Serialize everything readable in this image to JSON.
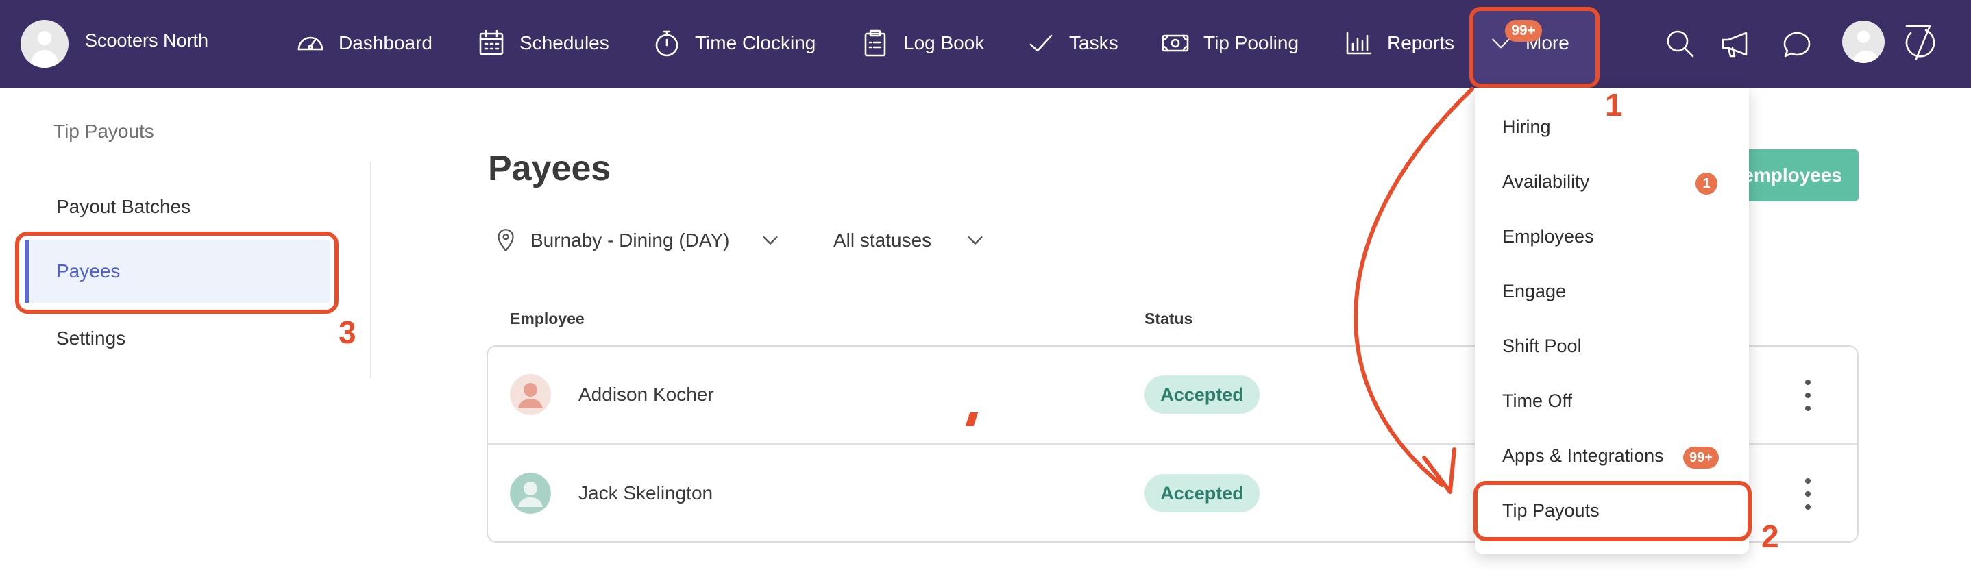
{
  "header": {
    "brand_name": "Scooters North",
    "nav": [
      {
        "label": "Dashboard",
        "icon": "dashboard-icon"
      },
      {
        "label": "Schedules",
        "icon": "calendar-icon"
      },
      {
        "label": "Time Clocking",
        "icon": "stopwatch-icon"
      },
      {
        "label": "Log Book",
        "icon": "clipboard-icon"
      },
      {
        "label": "Tasks",
        "icon": "checkmark-icon"
      },
      {
        "label": "Tip Pooling",
        "icon": "cash-icon"
      },
      {
        "label": "Reports",
        "icon": "bar-chart-icon"
      }
    ],
    "more_label": "More",
    "more_badge": "99+",
    "utility_icons": [
      "search-icon",
      "megaphone-icon",
      "chat-icon",
      "avatar",
      "logo-icon"
    ]
  },
  "sidebar": {
    "title": "Tip Payouts",
    "items": [
      {
        "label": "Payout Batches",
        "active": false
      },
      {
        "label": "Payees",
        "active": true
      },
      {
        "label": "Settings",
        "active": false
      }
    ]
  },
  "main": {
    "title": "Payees",
    "location_filter": "Burnaby - Dining (DAY)",
    "status_filter": "All statuses",
    "primary_button": "employees",
    "columns": [
      "Employee",
      "Status"
    ],
    "rows": [
      {
        "name": "Addison Kocher",
        "status": "Accepted",
        "avatar_color": "#f1d6cf"
      },
      {
        "name": "Jack Skelington",
        "status": "Accepted",
        "avatar_color": "#b6d9d0"
      }
    ]
  },
  "dropdown": {
    "items": [
      {
        "label": "Hiring",
        "badge": ""
      },
      {
        "label": "Availability",
        "badge": "1"
      },
      {
        "label": "Employees",
        "badge": ""
      },
      {
        "label": "Engage",
        "badge": ""
      },
      {
        "label": "Shift Pool",
        "badge": ""
      },
      {
        "label": "Time Off",
        "badge": ""
      },
      {
        "label": "Apps & Integrations",
        "badge": "99+"
      },
      {
        "label": "Tip Payouts",
        "badge": ""
      }
    ]
  },
  "annotations": {
    "step1": "1",
    "step2": "2",
    "step3": "3"
  },
  "colors": {
    "nav_bg": "#3c2f66",
    "accent_annotation": "#e84e2c",
    "badge": "#e8734d",
    "primary_button": "#5fbfa4",
    "status_pill_bg": "#cfece5",
    "status_pill_text": "#2d7d6a",
    "active_sidebar": "#4e5fcf"
  }
}
